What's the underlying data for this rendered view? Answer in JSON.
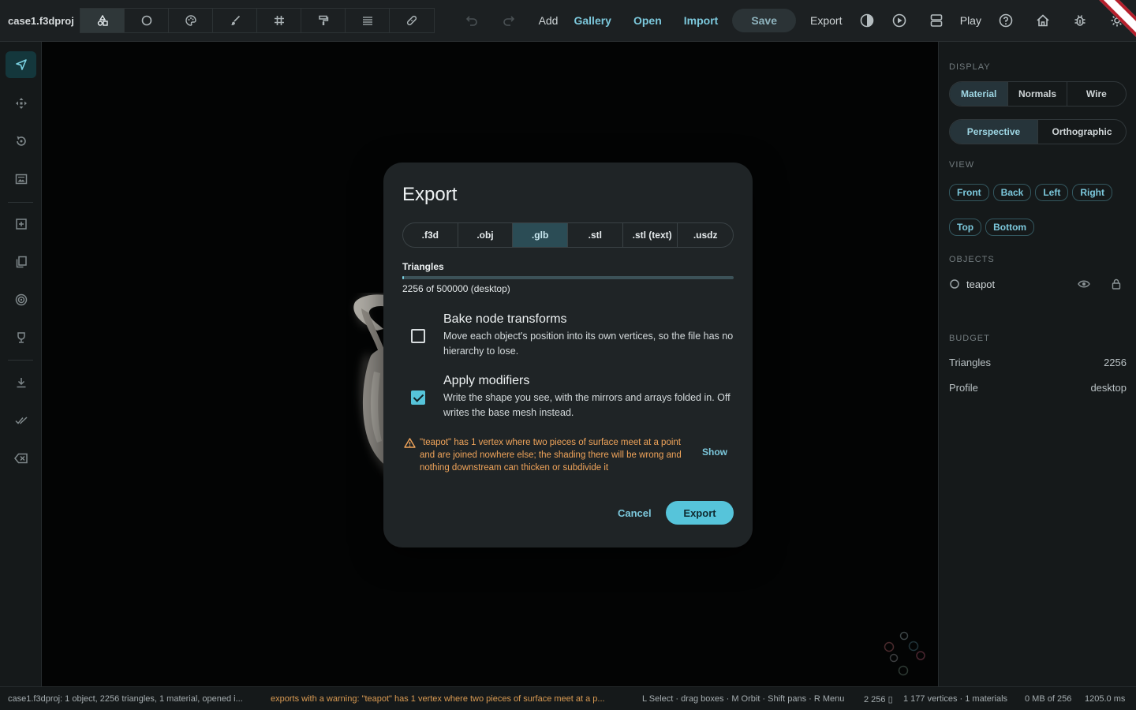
{
  "project_name": "case1.f3dproj",
  "mode_icons": [
    "shapes-icon",
    "circle-icon",
    "palette-icon",
    "brush-icon",
    "grid-icon",
    "paint-roller-icon",
    "layers-icon",
    "bandage-icon"
  ],
  "toolbar": {
    "add": "Add",
    "gallery": "Gallery",
    "open": "Open",
    "import": "Import",
    "save": "Save",
    "export": "Export",
    "play": "Play"
  },
  "left_tools": [
    "cursor-icon",
    "move-icon",
    "rotate-icon",
    "image-icon",
    "add-box-icon",
    "copy-icon",
    "target-icon",
    "trophy-icon",
    "download-icon",
    "double-check-icon",
    "backspace-icon"
  ],
  "right_panel": {
    "display_header": "DISPLAY",
    "display_modes": [
      "Material",
      "Normals",
      "Wire"
    ],
    "display_active": "Material",
    "projection_modes": [
      "Perspective",
      "Orthographic"
    ],
    "projection_active": "Perspective",
    "view_header": "VIEW",
    "view_row1": [
      "Front",
      "Back",
      "Left",
      "Right"
    ],
    "view_row2": [
      "Top",
      "Bottom"
    ],
    "objects_header": "OBJECTS",
    "object_name": "teapot",
    "budget_header": "BUDGET",
    "budget_triangles_label": "Triangles",
    "budget_triangles_value": "2256",
    "budget_profile_label": "Profile",
    "budget_profile_value": "desktop"
  },
  "dialog": {
    "title": "Export",
    "formats": [
      ".f3d",
      ".obj",
      ".glb",
      ".stl",
      ".stl (text)",
      ".usdz"
    ],
    "format_active": ".glb",
    "triangles_label": "Triangles",
    "triangles_value": 2256,
    "triangles_max": 500000,
    "triangles_text": "2256 of 500000 (desktop)",
    "bake_title": "Bake node transforms",
    "bake_desc": "Move each object's position into its own vertices, so the file has no hierarchy to lose.",
    "bake_checked": false,
    "modifiers_title": "Apply modifiers",
    "modifiers_desc": "Write the shape you see, with the mirrors and arrays folded in. Off writes the base mesh instead.",
    "modifiers_checked": true,
    "warning_text": "\"teapot\" has 1 vertex where two pieces of surface meet at a point and are joined nowhere else; the shading there will be wrong and nothing downstream can thicken or subdivide it",
    "show_label": "Show",
    "cancel_label": "Cancel",
    "export_label": "Export"
  },
  "statusbar": {
    "summary": "case1.f3dproj: 1 object, 2256 triangles, 1 material, opened i...",
    "warning": "exports with a warning: \"teapot\" has 1 vertex where two pieces of surface meet at a p...",
    "hints": "L Select · drag boxes · M Orbit · Shift pans · R Menu",
    "tri_count": "2 256 ▯",
    "vertices": "1 177 vertices · 1 materials",
    "memory": "0 MB of 256",
    "timing": "1205.0 ms"
  },
  "colors": {
    "accent": "#56c4da",
    "warning": "#f0a45a",
    "background": "#0b0d0e"
  }
}
